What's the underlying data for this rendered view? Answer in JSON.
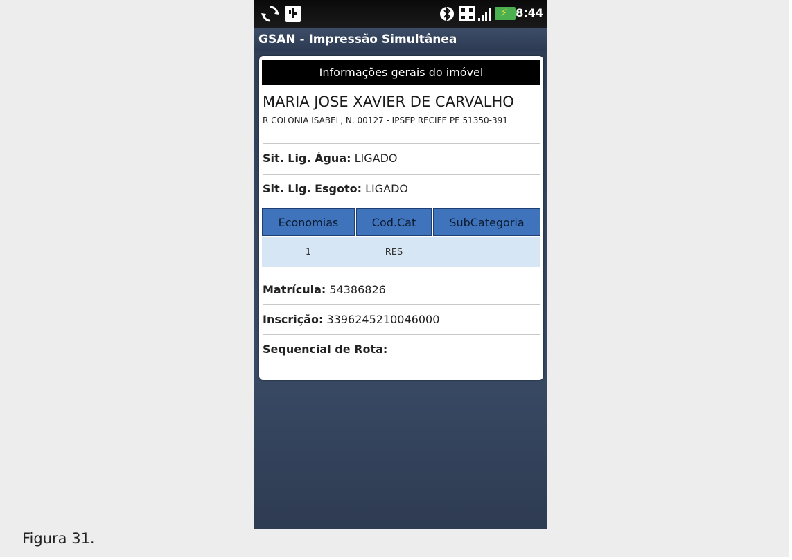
{
  "status_bar": {
    "time": "8:44",
    "icons": [
      "sync-icon",
      "usb-icon",
      "bluetooth-icon",
      "keypad-icon",
      "signal-icon",
      "battery-charging-icon"
    ]
  },
  "app": {
    "title": "GSAN - Impressão Simultânea"
  },
  "card": {
    "header": "Informações gerais do imóvel",
    "owner_name": "MARIA JOSE XAVIER DE CARVALHO",
    "address": "R COLONIA ISABEL, N. 00127 - IPSEP RECIFE PE 51350-391",
    "agua_label": "Sit. Lig. Água:",
    "agua_value": "LIGADO",
    "esgoto_label": "Sit. Lig. Esgoto:",
    "esgoto_value": "LIGADO",
    "table": {
      "headers": [
        "Economias",
        "Cod.Cat",
        "SubCategoria"
      ],
      "rows": [
        [
          "1",
          "RES",
          ""
        ]
      ]
    },
    "matricula_label": "Matrícula:",
    "matricula_value": "54386826",
    "inscricao_label": "Inscrição:",
    "inscricao_value": "3396245210046000",
    "sequencial_label": "Sequencial de Rota:",
    "sequencial_value": ""
  },
  "caption": "Figura 31.",
  "colors": {
    "table_header_bg": "#3f74bd",
    "table_row_bg": "#d7e6f4",
    "titlebar_bg": "#2c3a52",
    "battery": "#4caf50"
  }
}
